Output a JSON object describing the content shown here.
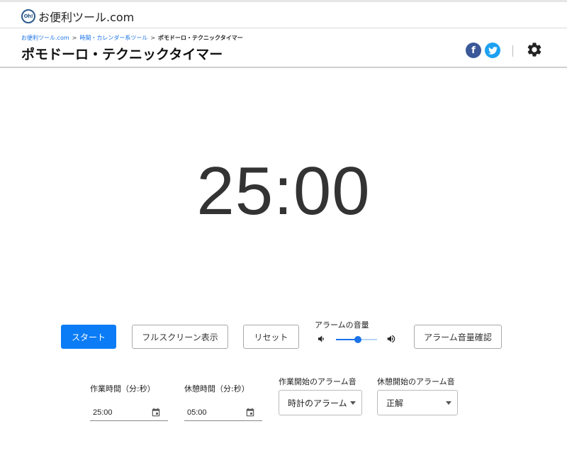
{
  "site": {
    "badge": "Oh!",
    "name": "お便利ツール.com"
  },
  "breadcrumb": [
    {
      "label": "お便利ツール.com"
    },
    {
      "label": "時間・カレンダー系ツール"
    },
    {
      "label": "ポモドーロ・テクニックタイマー"
    }
  ],
  "breadcrumb_separator": ">",
  "page_title": "ポモドーロ・テクニックタイマー",
  "social": {
    "facebook_glyph": "f",
    "twitter_glyph": "t",
    "facebook_color": "#3b5998",
    "twitter_color": "#1da1f2"
  },
  "timer": {
    "display": "25:00"
  },
  "controls": {
    "start_label": "スタート",
    "fullscreen_label": "フルスクリーン表示",
    "reset_label": "リセット",
    "volume_label": "アラームの音量",
    "volume_level": 0.54,
    "check_volume_label": "アラーム音量確認"
  },
  "settings": {
    "work_time_label": "作業時間（分:秒）",
    "work_time_value": "25:00",
    "break_time_label": "休憩時間（分:秒）",
    "break_time_value": "05:00",
    "work_alarm_label": "作業開始のアラーム音",
    "work_alarm_value": "時計のアラーム",
    "break_alarm_label": "休憩開始のアラーム音",
    "break_alarm_value": "正解"
  },
  "colors": {
    "primary": "#0b7cf5",
    "link": "#1a73e8"
  }
}
